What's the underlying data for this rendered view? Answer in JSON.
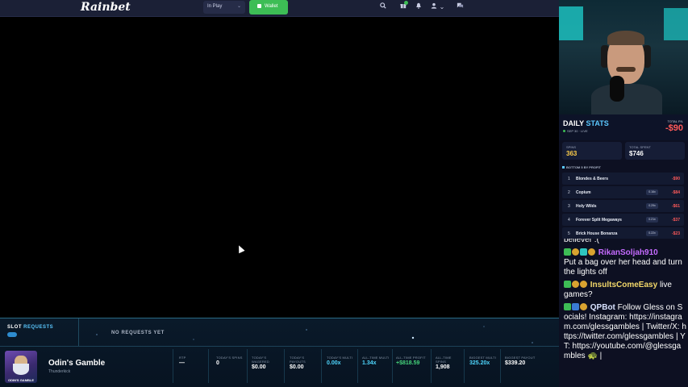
{
  "topbar": {
    "logo": "Rainbet",
    "select_value": "In Play",
    "wallet_label": "Wallet",
    "icons": [
      "search-icon",
      "gift-icon",
      "bell-icon",
      "user-icon",
      "chat-icon"
    ]
  },
  "slot_requests": {
    "title": "SLOT",
    "title_accent": "REQUESTS",
    "empty": "NO REQUESTS YET"
  },
  "current_game": {
    "thumb_text": "ODIN'S GAMBLE",
    "name": "Odin's Gamble",
    "provider": "Thunderkick",
    "stats": [
      {
        "label": "RTP",
        "value": "—"
      },
      {
        "label": "TODAY'S SPINS",
        "value": "0"
      },
      {
        "label": "TODAY'S WAGERED",
        "value": "$0.00"
      },
      {
        "label": "TODAY'S PAYOUTS",
        "value": "$0.00"
      },
      {
        "label": "TODAY'S MULTI",
        "value": "0.00x"
      },
      {
        "label": "ALL-TIME MULTI",
        "value": "1.34x"
      },
      {
        "label": "ALL-TIME PROFIT",
        "value": "+$818.59"
      },
      {
        "label": "ALL-TIME SPINS",
        "value": "1,908"
      },
      {
        "label": "BIGGEST MULTI",
        "value": "325.20x"
      },
      {
        "label": "BIGGEST PAYOUT",
        "value": "$339.20"
      }
    ]
  },
  "daily": {
    "title": "DAILY",
    "title_accent": "STATS",
    "date": "SEP 30 · LIVE",
    "pl_label": "TOTAL P/L",
    "pl_value": "-$90",
    "spins_label": "SPINS",
    "spins_value": "363",
    "spent_label": "TOTAL SPENT",
    "spent_value": "$746",
    "bottom_title": "BOTTOM 5 BY PROFIT",
    "bottom": [
      {
        "rank": "1",
        "name": "Blondes & Beers",
        "multi": "",
        "amount": "-$90"
      },
      {
        "rank": "2",
        "name": "Copium",
        "multi": "0.16x",
        "amount": "-$84"
      },
      {
        "rank": "3",
        "name": "Holy Wilds",
        "multi": "0.29x",
        "amount": "-$61"
      },
      {
        "rank": "4",
        "name": "Forever Split Megaways",
        "multi": "0.21x",
        "amount": "-$37"
      },
      {
        "rank": "5",
        "name": "Brick House Bonanza",
        "multi": "0.22x",
        "amount": "-$23"
      }
    ]
  },
  "chat": {
    "cut_line": "believer :(",
    "messages": [
      {
        "user": "RikanSoljah910",
        "text": "Put a bag over her head and turn the lights off"
      },
      {
        "user": "InsultsComeEasy",
        "text": "live games?"
      },
      {
        "user": "QPBot",
        "text": "Follow Gless on Socials! Instagram: https://instagram.com/glessgambles | Twitter/X: https://twitter.com/glessgambles | YT: https://youtube.com/@glessgambles 🐢 |"
      }
    ]
  },
  "colors": {
    "accent": "#5bc8ff",
    "wallet": "#3dbd55",
    "negative": "#ff5a5a",
    "gold": "#ffcf4a"
  }
}
